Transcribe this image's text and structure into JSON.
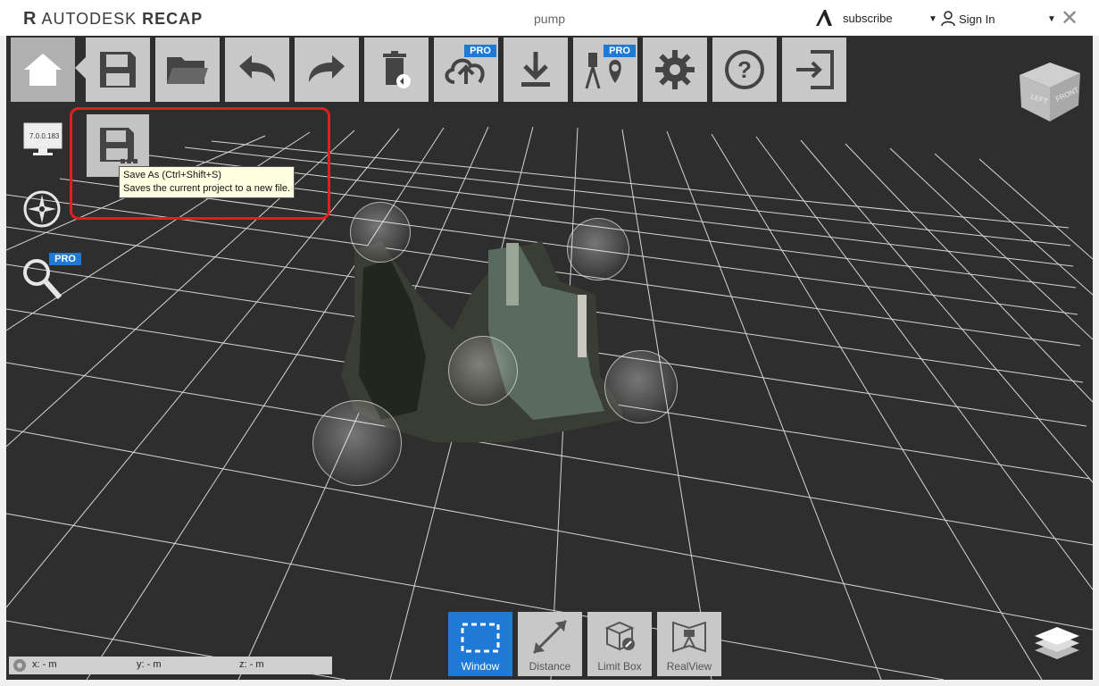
{
  "app": {
    "brand_word1": "AUTODESK",
    "brand_word2": "RECAP",
    "document_title": "pump",
    "subscribe_label": "subscribe",
    "signin_label": "Sign In"
  },
  "toolbar": {
    "buttons": [
      {
        "name": "home-button",
        "icon": "home-icon"
      },
      {
        "name": "save-button",
        "icon": "save-icon"
      },
      {
        "name": "open-button",
        "icon": "folder-icon"
      },
      {
        "name": "undo-button",
        "icon": "undo-icon"
      },
      {
        "name": "redo-button",
        "icon": "redo-icon"
      },
      {
        "name": "delete-button",
        "icon": "trash-icon"
      },
      {
        "name": "upload-button",
        "icon": "cloud-upload-icon",
        "badge": "PRO"
      },
      {
        "name": "download-button",
        "icon": "download-icon"
      },
      {
        "name": "scan-locate-button",
        "icon": "scanner-icon",
        "badge": "PRO"
      },
      {
        "name": "settings-button",
        "icon": "gear-icon"
      },
      {
        "name": "help-button",
        "icon": "help-icon"
      },
      {
        "name": "exit-button",
        "icon": "exit-icon"
      }
    ]
  },
  "side": {
    "monitor_label": "7.0.0.183",
    "search_badge": "PRO"
  },
  "tooltip": {
    "line1": "Save As (Ctrl+Shift+S)",
    "line2": "Saves the current project to a new file."
  },
  "viewcube": {
    "left": "LEFT",
    "front": "FRONT"
  },
  "bottom_tools": [
    {
      "label": "Window",
      "active": true
    },
    {
      "label": "Distance",
      "active": false
    },
    {
      "label": "Limit Box",
      "active": false
    },
    {
      "label": "RealView",
      "active": false
    }
  ],
  "coords": {
    "x": "x:  -  m",
    "y": "y:  -  m",
    "z": "z:  -  m"
  },
  "colors": {
    "accent": "#1e7ad6",
    "highlight": "#e02020",
    "viewport_bg": "#2e2e2e"
  }
}
